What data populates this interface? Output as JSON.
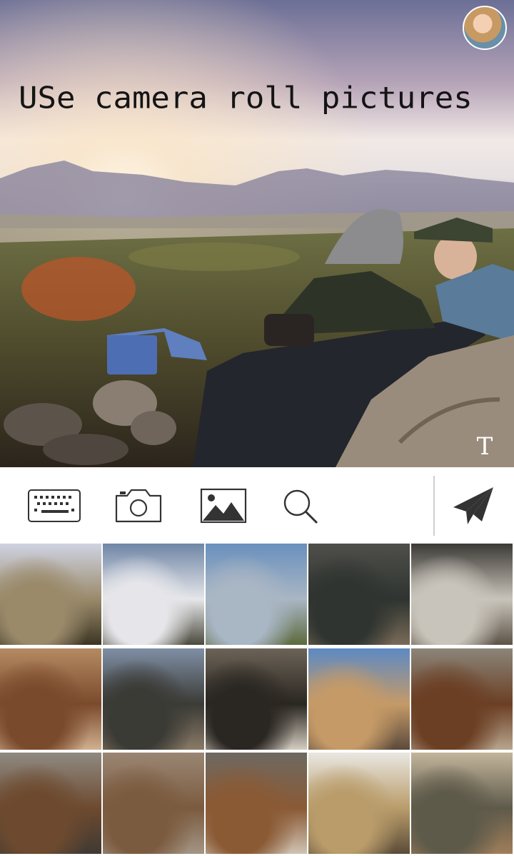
{
  "hero": {
    "caption": "USe camera roll pictures",
    "text_tool_label": "T"
  },
  "toolbar": {
    "icons": [
      "keyboard-icon",
      "camera-icon",
      "image-icon",
      "search-icon",
      "send-icon"
    ]
  },
  "gallery": {
    "thumbnails": [
      {
        "name": "sunset-campfire",
        "colors": [
          "#cfd3e2",
          "#9a8a6a",
          "#3c3524"
        ]
      },
      {
        "name": "cloudy-mountains",
        "colors": [
          "#6f86a6",
          "#e6e6ea",
          "#4a4a3c"
        ]
      },
      {
        "name": "valley-view",
        "colors": [
          "#6a90bd",
          "#a9b6c4",
          "#5c6a3c"
        ]
      },
      {
        "name": "rubber-duck-rocks",
        "colors": [
          "#4f4f4a",
          "#2f3430",
          "#7a6b58"
        ]
      },
      {
        "name": "duck-newspaper",
        "colors": [
          "#3c3a35",
          "#c9c4bb",
          "#5d5347"
        ]
      },
      {
        "name": "sleeping-dog",
        "colors": [
          "#b58a62",
          "#7a4a2c",
          "#d1b190"
        ]
      },
      {
        "name": "jeep-trail",
        "colors": [
          "#7f8fa5",
          "#3b3b36",
          "#8a7a66"
        ]
      },
      {
        "name": "dog-forest",
        "colors": [
          "#6c6357",
          "#2a2621",
          "#d4ccc0"
        ]
      },
      {
        "name": "friends-boulders",
        "colors": [
          "#5d8ac4",
          "#c59a67",
          "#5b4a3c"
        ]
      },
      {
        "name": "dog-portrait",
        "colors": [
          "#8b8579",
          "#6b3f24",
          "#b7a58e"
        ]
      },
      {
        "name": "dog-bushes",
        "colors": [
          "#8f8a82",
          "#6d4a2f",
          "#3f3a33"
        ]
      },
      {
        "name": "dog-closeup-blur",
        "colors": [
          "#9a8674",
          "#7b5b3f",
          "#a39585"
        ]
      },
      {
        "name": "dog-closeup",
        "colors": [
          "#6e6961",
          "#8a5a35",
          "#cfc3b3"
        ]
      },
      {
        "name": "jumping-friends",
        "colors": [
          "#e9e7e2",
          "#b99c6a",
          "#5b4c38"
        ]
      },
      {
        "name": "jeep-group",
        "colors": [
          "#c3b59c",
          "#5e5a4a",
          "#a07e5a"
        ]
      }
    ]
  }
}
